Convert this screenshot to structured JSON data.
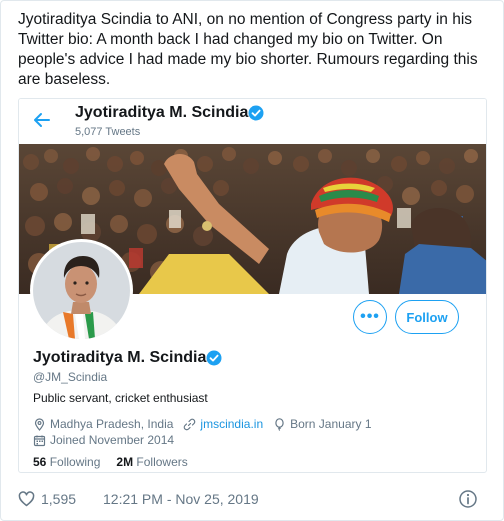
{
  "tweet": {
    "text": "Jyotiraditya Scindia to ANI, on no mention of Congress party in his Twitter bio: A month back I had changed my bio on Twitter. On people's advice I had made my bio shorter. Rumours regarding this are baseless.",
    "likes": "1,595",
    "timestamp": "12:21 PM - Nov 25, 2019"
  },
  "profile_card": {
    "header_name": "Jyotiraditya M. Scindia",
    "tweet_count": "5,077 Tweets",
    "name": "Jyotiraditya M. Scindia",
    "handle": "@JM_Scindia",
    "bio": "Public servant, cricket enthusiast",
    "location": "Madhya Pradesh, India",
    "website": "jmscindia.in",
    "birthday": "Born January 1",
    "joined": "Joined November 2014",
    "following_count": "56",
    "following_label": "Following",
    "followers_count": "2M",
    "followers_label": "Followers",
    "more_label": "•••",
    "follow_label": "Follow"
  },
  "colors": {
    "accent": "#1da1f2",
    "link": "#1b95e0",
    "muted": "#657786",
    "text": "#14171a"
  },
  "icons": [
    "back-arrow-icon",
    "verified-badge-icon",
    "location-pin-icon",
    "link-icon",
    "balloon-icon",
    "calendar-icon",
    "heart-icon",
    "info-icon"
  ]
}
